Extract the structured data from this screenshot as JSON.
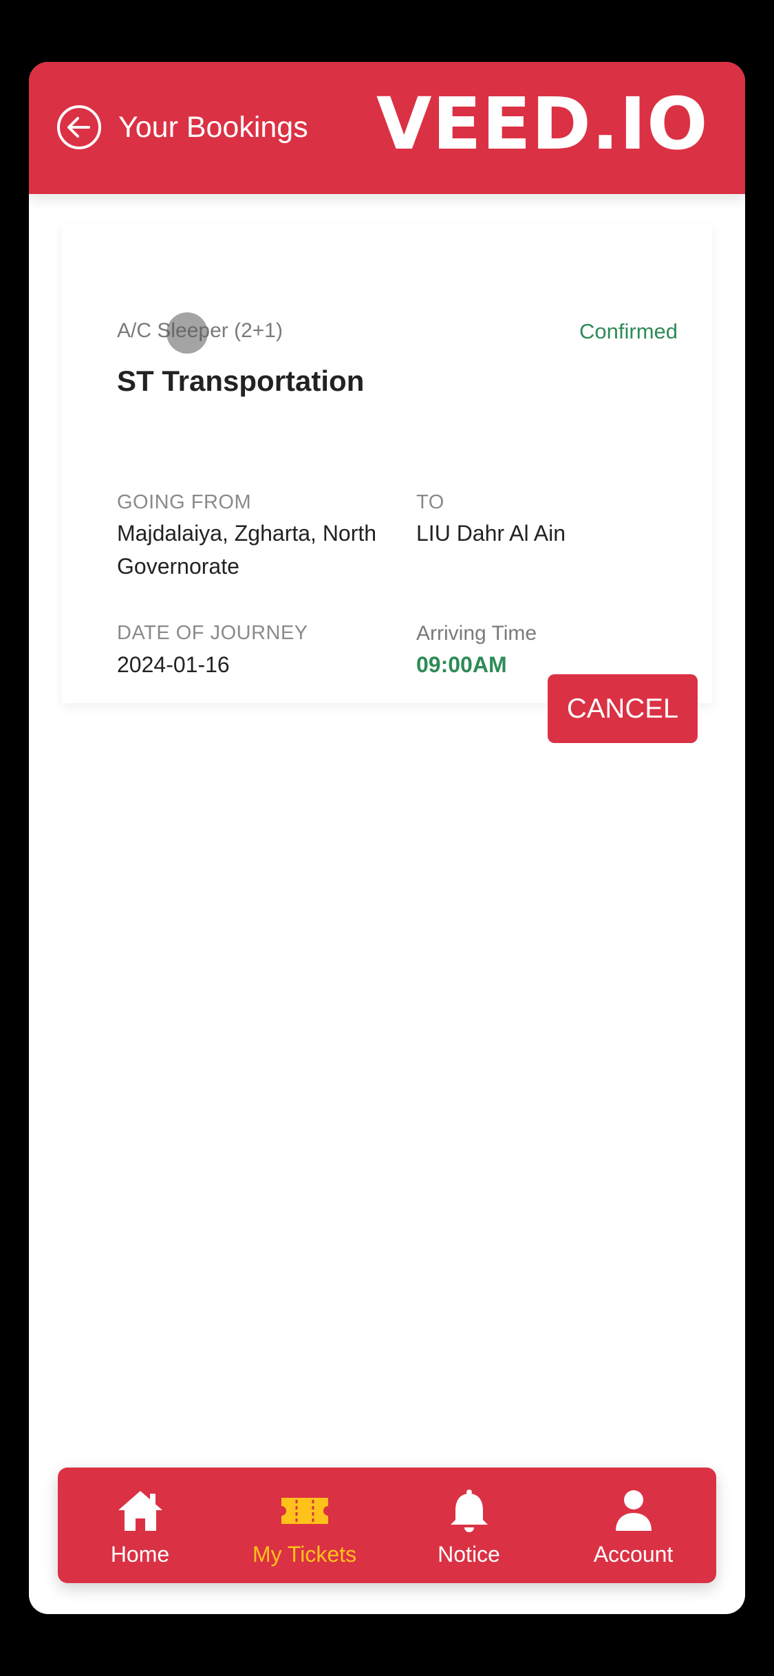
{
  "header": {
    "title": "Your Bookings",
    "brand": "VEED.IO"
  },
  "booking": {
    "bus_class": "A/C Sleeper (2+1)",
    "status": "Confirmed",
    "operator": "ST Transportation",
    "going_from_label": "GOING FROM",
    "going_from_value": "Majdalaiya, Zgharta, North Governorate",
    "to_label": "TO",
    "to_value": "LIU Dahr Al Ain",
    "date_label": "DATE OF JOURNEY",
    "date_value": "2024-01-16",
    "arriving_label": "Arriving Time",
    "arriving_value": "09:00AM",
    "cancel_label": "CANCEL"
  },
  "bottom_nav": {
    "items": [
      {
        "label": "Home",
        "icon": "home-icon"
      },
      {
        "label": "My Tickets",
        "icon": "ticket-icon",
        "active": true
      },
      {
        "label": "Notice",
        "icon": "bell-icon"
      },
      {
        "label": "Account",
        "icon": "person-icon"
      }
    ]
  },
  "colors": {
    "primary": "#db3144",
    "active_nav": "#ffc21a",
    "success": "#2e8b57"
  }
}
